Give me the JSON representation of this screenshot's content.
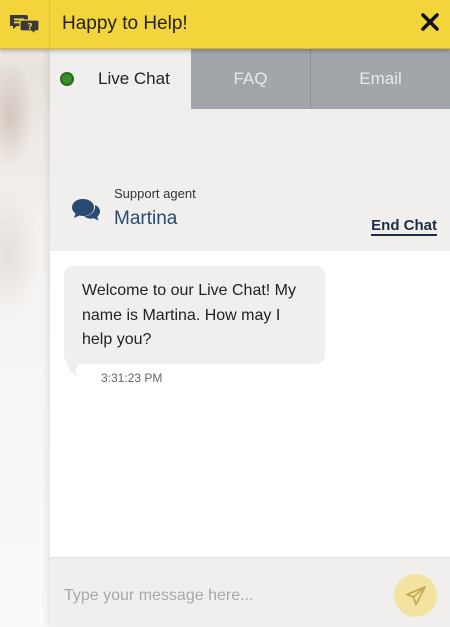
{
  "header": {
    "title": "Happy to Help!",
    "logo_icon": "chat-question-icon",
    "close_icon": "close-icon",
    "background_color": "#f3d43a"
  },
  "tabs": [
    {
      "label": "Live Chat",
      "active": true,
      "status_color": "#3a8f2c"
    },
    {
      "label": "FAQ",
      "active": false
    },
    {
      "label": "Email",
      "active": false
    }
  ],
  "agent": {
    "role": "Support agent",
    "name": "Martina",
    "icon": "chat-bubbles-icon",
    "end_chat_label": "End Chat"
  },
  "messages": [
    {
      "text": "Welcome to our Live Chat! My name is Martina. How may I help you?",
      "time": "3:31:23 PM",
      "from": "agent"
    }
  ],
  "composer": {
    "placeholder": "Type your message here...",
    "value": "",
    "send_icon": "send-icon"
  }
}
